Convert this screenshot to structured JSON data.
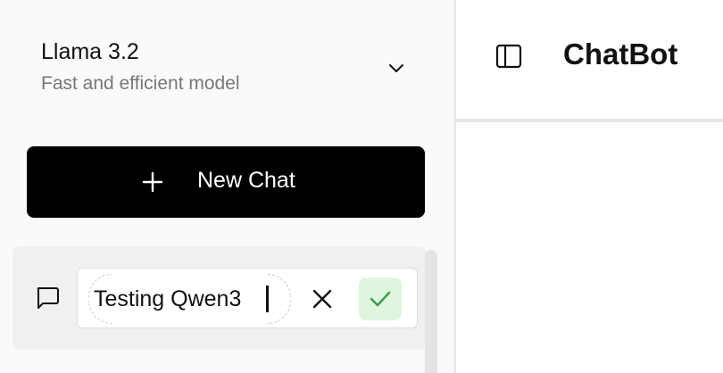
{
  "model_selector": {
    "name": "Llama 3.2",
    "description": "Fast and efficient model",
    "icon": "chevron-down-icon"
  },
  "new_chat": {
    "label": "New Chat",
    "icon": "plus-icon"
  },
  "chat_list": {
    "items": [
      {
        "icon": "chat-bubble-icon",
        "rename_value": "Testing Qwen3",
        "cancel_icon": "close-icon",
        "confirm_icon": "check-icon"
      }
    ]
  },
  "header": {
    "title": "ChatBot",
    "toggle_icon": "sidebar-toggle-icon"
  },
  "colors": {
    "primary_button": "#000000",
    "confirm_bg": "#dff5df",
    "confirm_check": "#3a9a4a",
    "muted_text": "#777777"
  }
}
